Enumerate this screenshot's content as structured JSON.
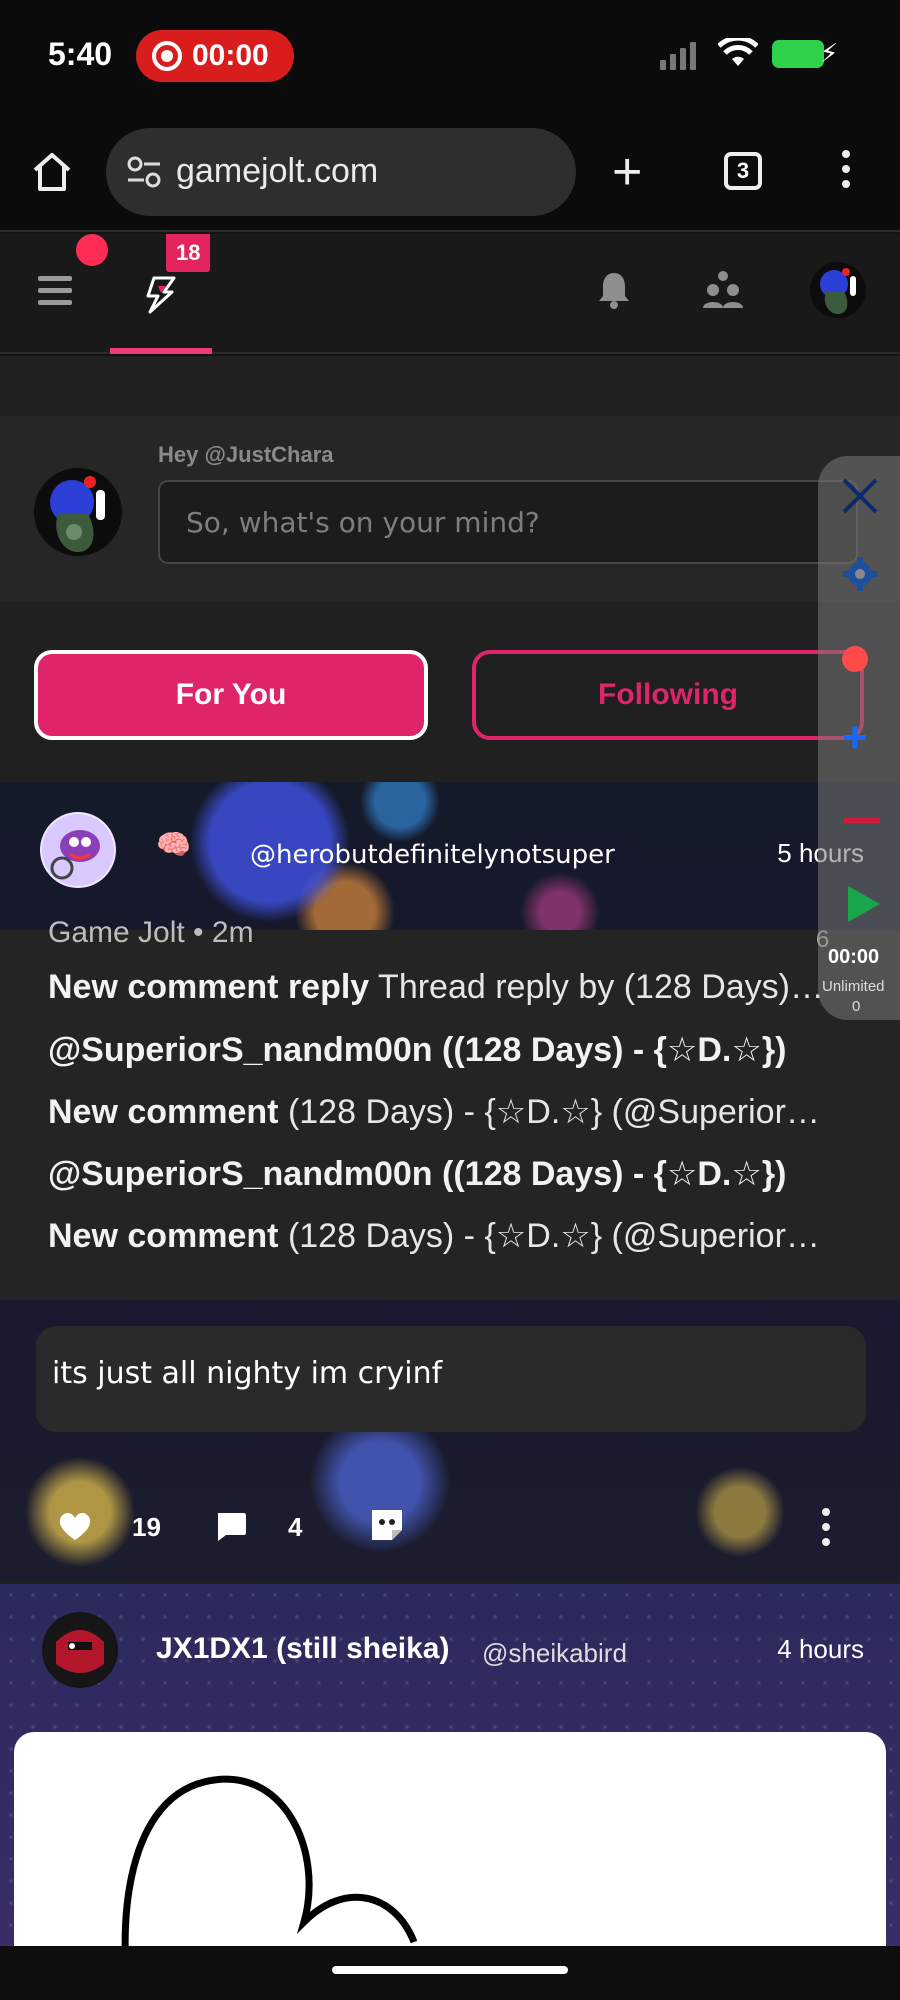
{
  "status_bar": {
    "time": "5:40",
    "recording_time": "00:00",
    "colors": {
      "record": "#d91d1d",
      "battery": "#2fd14b"
    }
  },
  "browser": {
    "url": "gamejolt.com",
    "tab_count": "3",
    "icons": [
      "home-icon",
      "site-settings-icon",
      "new-tab-icon",
      "tabs-icon",
      "more-icon"
    ]
  },
  "gj_nav": {
    "feed_badge": "18",
    "accent": "#f03a78",
    "icons": [
      "menu-icon",
      "activity-feed-icon",
      "notifications-bell-icon",
      "friends-icon",
      "user-avatar"
    ]
  },
  "composer": {
    "greeting": "Hey @JustChara",
    "placeholder": "So, what's on your mind?"
  },
  "feed_tabs": {
    "for_you": "For You",
    "following": "Following",
    "active": "For You"
  },
  "post1": {
    "name_glyphs": "🧠",
    "handle": "@herobutdefinitelynotsuper",
    "time": "5 hours",
    "screenshot": {
      "cut_header": "Game Jolt • 2m",
      "side_num": "6",
      "lines": [
        {
          "bold": "New comment reply",
          "text": " Thread reply by (128 Days)…"
        },
        {
          "bold": "@SuperiorS_nandm00n ((128 Days) - {☆D.☆})",
          "text": ""
        },
        {
          "bold": "New comment",
          "text": " (128 Days) - {☆D.☆} (@Superior…"
        },
        {
          "bold": "@SuperiorS_nandm00n ((128 Days) - {☆D.☆})",
          "text": ""
        },
        {
          "bold": "New comment",
          "text": " (128 Days) - {☆D.☆} (@Superior…"
        }
      ]
    },
    "caption": "its just all nighty im cryinf",
    "likes": "19",
    "comments": "4"
  },
  "post2": {
    "name": "JX1DX1 (still sheika)",
    "handle": "@sheikabird",
    "time": "4 hours"
  },
  "recorder_panel": {
    "time": "00:00",
    "limit": "Unlimited",
    "count": "0"
  }
}
